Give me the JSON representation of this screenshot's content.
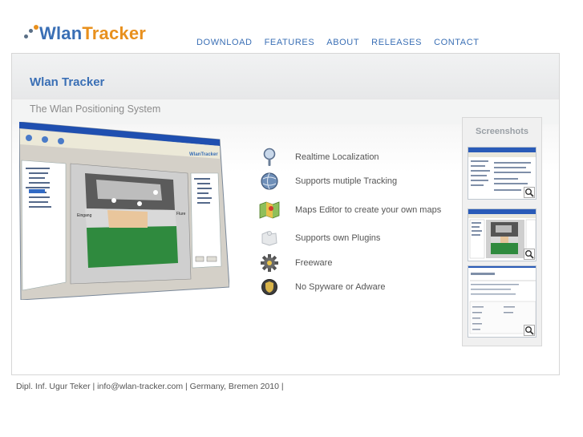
{
  "brand": {
    "part1": "Wlan",
    "part2": "Tracker"
  },
  "nav": {
    "download": "DOWNLOAD",
    "features": "FEATURES",
    "about": "ABOUT",
    "releases": "RELEASES",
    "contact": "CONTACT"
  },
  "main": {
    "title": "Wlan Tracker",
    "subtitle": "The Wlan Positioning System"
  },
  "features": [
    {
      "label": "Realtime Localization",
      "icon": "magnifier-pin-icon"
    },
    {
      "label": "Supports mutiple Tracking",
      "icon": "globe-icon"
    },
    {
      "label": "Maps Editor to create your own maps",
      "icon": "map-icon"
    },
    {
      "label": "Supports own Plugins",
      "icon": "puzzle-icon"
    },
    {
      "label": "Freeware",
      "icon": "gear-icon"
    },
    {
      "label": "No Spyware or Adware",
      "icon": "shield-icon"
    }
  ],
  "screenshots": {
    "title": "Screenshots"
  },
  "footer": {
    "text": "Dipl. Inf. Ugur Teker | info@wlan-tracker.com | Germany, Bremen 2010 |"
  },
  "colors": {
    "accent": "#3a6fb5",
    "brand_orange": "#e8901d"
  }
}
